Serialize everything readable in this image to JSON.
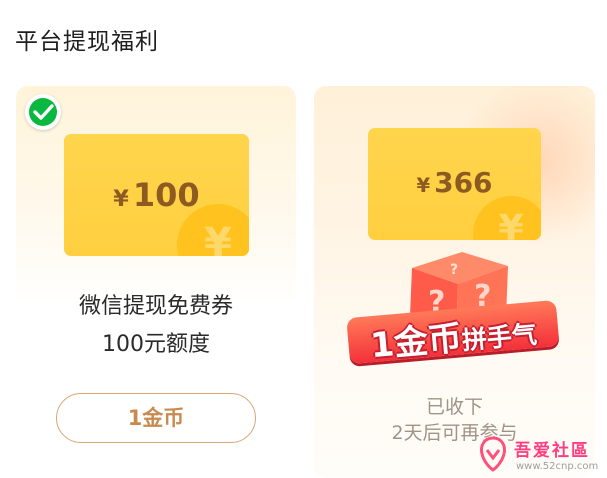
{
  "page_title": "平台提现福利",
  "cards": [
    {
      "coupon": {
        "currency": "¥",
        "amount": "100",
        "yen_mark": "¥"
      },
      "title": "微信提现免费券",
      "subtitle": "100元额度",
      "button_label": "1金币"
    },
    {
      "coupon": {
        "currency": "¥",
        "amount": "366",
        "yen_mark": "¥"
      },
      "promo_banner_main": "1金币",
      "promo_banner_sub": "拼手气",
      "status_line1": "已收下",
      "status_line2": "2天后可再参与"
    }
  ],
  "watermark": {
    "text": "吾爱社區",
    "url": "www.52cnp.com"
  },
  "colors": {
    "accent_gold": "#ffd54d",
    "amount_brown": "#8d5a22",
    "button_border": "#d8a776",
    "banner_red": "#f4303a",
    "wechat_green": "#09b83e"
  },
  "icons": [
    "wechat-icon",
    "yen-icon",
    "mystery-box-icon",
    "watermark-logo-icon"
  ]
}
